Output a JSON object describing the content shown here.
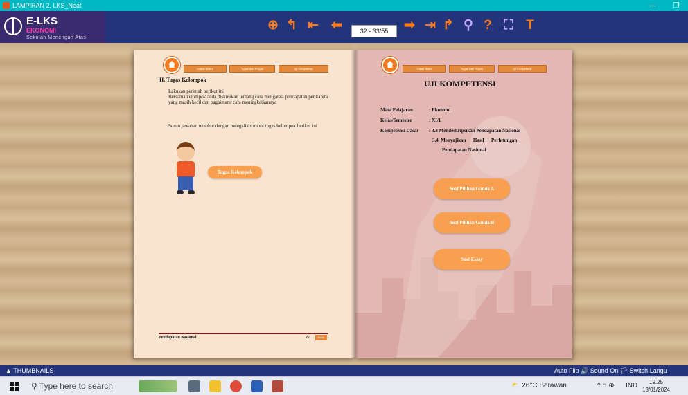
{
  "window": {
    "title": "LAMPIRAN 2. LKS_Neat",
    "minimize": "—",
    "restore": "❐"
  },
  "header": {
    "logo_title": "E-LKS",
    "logo_sub1": "EKONOMI",
    "logo_sub2": "Sekolah Menengah Atas",
    "page_indicator": "32 - 33/55",
    "icons": [
      "zoom-in-icon",
      "undo-icon",
      "first-page-icon",
      "prev-page-icon",
      "next-page-icon",
      "last-page-icon",
      "redo-icon",
      "search-icon",
      "help-icon",
      "fullscreen-icon",
      "text-icon"
    ]
  },
  "left_page": {
    "tabs": [
      "Uraian Materi",
      "Tugas dan Proyek",
      "Uji Kompetensi"
    ],
    "heading": "II. Tugas Kelompok",
    "para1": "Lakukan perintah berikut ini",
    "para2": "Bersama kelompok anda diskusikan tentang cara mengatasi pendapatan per kapita yang masih kecil dan bagaimana cara meningkatkannya",
    "para3": "Susun jawaban tersebut dengan mengklik tombol tugas kelompok berikut ini",
    "button": "Tugas Kelompok",
    "footer_title": "Pendapatan Nasional",
    "footer_page": "27",
    "back": "Back"
  },
  "right_page": {
    "tabs": [
      "Uraian Materi",
      "Tugas dan Proyek",
      "Uji Kompetensi"
    ],
    "title": "UJI KOMPETENSI",
    "mapel_label": "Mata Pelajaran",
    "mapel_value": ": Ekonomi",
    "kelas_label": "Kelas/Semester",
    "kelas_value": ": XI/1",
    "kd_label": "Kompetensi Dasar",
    "kd_value1": ": 3.3  Mendeskripsikan Pendapatan Nasional",
    "kd_value2": "3.4  Menyajikan      Hasil      Perhitungan",
    "kd_value3": "Pendapatan Nasional",
    "btn_a": "Soal Pilihan Ganda A",
    "btn_b": "Soal Pilihan Ganda B",
    "btn_essay": "Soal Essay"
  },
  "thumbbar": {
    "label": "THUMBNAILS",
    "right": "Auto Flip  🔊 Sound On  🏳 Switch Langu"
  },
  "taskbar": {
    "search": "Type here to search",
    "weather": "26°C  Berawan",
    "lang": "IND",
    "time": "19.25",
    "date": "13/01/2024"
  }
}
